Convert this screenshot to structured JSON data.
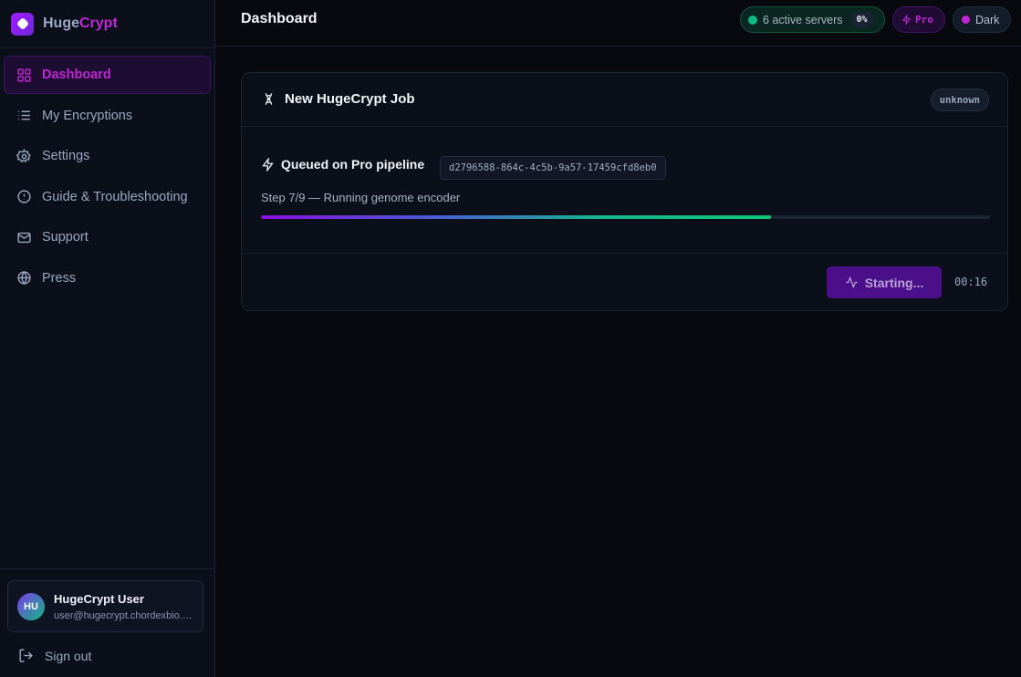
{
  "brand": {
    "part1": "Huge",
    "part2": "Crypt"
  },
  "sidebar": {
    "items": [
      {
        "label": "Dashboard",
        "icon": "grid-icon",
        "active": true
      },
      {
        "label": "My Encryptions",
        "icon": "list-icon"
      },
      {
        "label": "Settings",
        "icon": "gear-icon"
      },
      {
        "label": "Guide & Troubleshooting",
        "icon": "info-icon"
      },
      {
        "label": "Support",
        "icon": "mail-icon"
      },
      {
        "label": "Press",
        "icon": "globe-icon"
      }
    ]
  },
  "user": {
    "initials": "HU",
    "name": "HugeCrypt User",
    "email": "user@hugecrypt.chordexbio.com"
  },
  "signout": {
    "label": "Sign out"
  },
  "header": {
    "title": "Dashboard",
    "servers": {
      "label": "6 active servers",
      "percent": "0%"
    },
    "plan": "Pro",
    "theme": "Dark"
  },
  "job": {
    "title": "New HugeCrypt Job",
    "status_badge": "unknown",
    "queued_label": "Queued on Pro pipeline",
    "job_id": "d2796588-864c-4c5b-9a57-17459cfd8eb0",
    "step_text": "Step 7/9 — Running genome encoder",
    "progress_fraction": 0.7,
    "button_label": "Starting...",
    "elapsed": "00:16"
  },
  "colors": {
    "accent": "#c026d3",
    "success": "#10b981",
    "button": "#4c0f8a"
  }
}
